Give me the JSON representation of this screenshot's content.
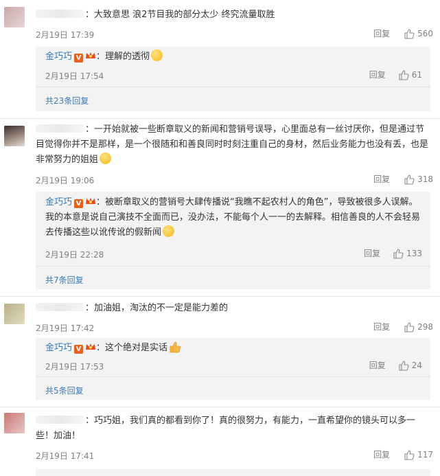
{
  "comments": [
    {
      "text": "：大致意思  浪2节目我的部分太少  终究流量取胜",
      "time": "2月19日 17:39",
      "reply_label": "回复",
      "likes": "560",
      "reply": {
        "author": "金巧巧",
        "text": "：理解的透彻",
        "time": "2月19日 17:54",
        "reply_label": "回复",
        "likes": "61"
      },
      "total_replies": "共23条回复"
    },
    {
      "text": "：一开始就被一些断章取义的新闻和营销号误导，心里面总有一丝讨厌你，但是通过节目觉得你并不是那样，是一个很随和和善良同时时刻注重自己的身材，然后业务能力也没有丢，也是非常努力的姐姐",
      "time": "2月19日 19:06",
      "reply_label": "回复",
      "likes": "318",
      "reply": {
        "author": "金巧巧",
        "text": "：被断章取义的营销号大肆传播说“我瞧不起农村人的角色”，导致被很多人误解。我的本意是说自己演技不全面而已，没办法，不能每个人一一的去解释。相信善良的人不会轻易去传播这些以讹传讹的假新闻",
        "time": "2月19日 22:28",
        "reply_label": "回复",
        "likes": "133"
      },
      "total_replies": "共7条回复"
    },
    {
      "text": "：加油姐，淘汰的不一定是能力差的",
      "time": "2月19日 17:42",
      "reply_label": "回复",
      "likes": "298",
      "reply": {
        "author": "金巧巧",
        "text": "：这个绝对是实话",
        "time": "2月19日 17:53",
        "reply_label": "回复",
        "likes": "24"
      },
      "total_replies": "共5条回复"
    },
    {
      "text": "：巧巧姐，我们真的都看到你了！真的很努力，有能力，一直希望你的镜头可以多一些！加油！",
      "time": "2月19日 17:41",
      "reply_label": "回复",
      "likes": "117"
    }
  ],
  "badges": {
    "verified": "V"
  },
  "colors": {
    "link": "#3a79b8",
    "meta": "#808080",
    "reply_bg": "#f3f3f3",
    "vbadge": "#e8601a"
  },
  "icons": [
    "thumbs-up-icon",
    "smile-emoji-icon",
    "thumbs-up-emoji-icon",
    "crown-icon",
    "verified-badge-icon"
  ]
}
